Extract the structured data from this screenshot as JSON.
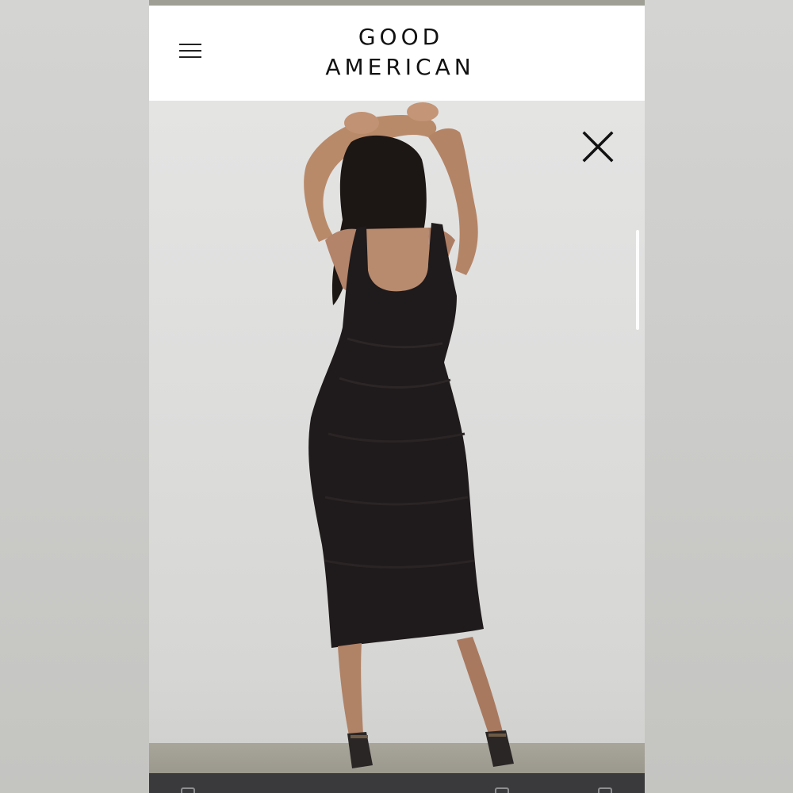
{
  "brand": {
    "line1": "GOOD",
    "line2": "AMERICAN"
  },
  "icons": {
    "menu": "hamburger-menu-icon",
    "close": "close-icon"
  },
  "product_image": {
    "description_hidden": "",
    "dress_color": "#1e1a1a"
  },
  "colors": {
    "header_bg": "#ffffff",
    "photo_bg": "#dddddc",
    "bottom_bar": "#3a3a3c"
  }
}
